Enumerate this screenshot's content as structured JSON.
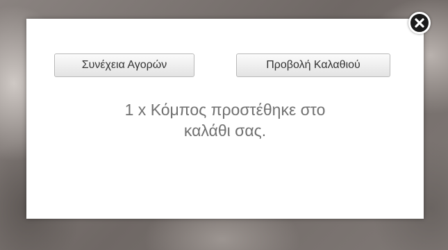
{
  "dialog": {
    "continue_label": "Συνέχεια Αγορών",
    "view_cart_label": "Προβολή Καλαθιού",
    "message_line1": "1 x Κόμπος προστέθηκε στο",
    "message_line2": "καλάθι σας."
  },
  "icons": {
    "close": "close-icon"
  },
  "colors": {
    "modal_background": "#ffffff",
    "message_text": "#707070",
    "close_button": "#1a1a1a"
  }
}
